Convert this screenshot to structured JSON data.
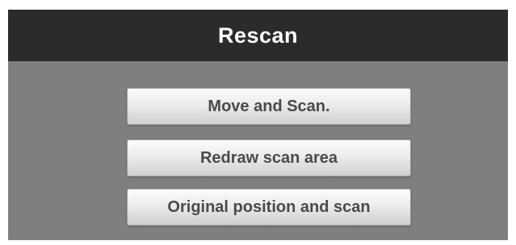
{
  "dialog": {
    "title": "Rescan",
    "buttons": [
      {
        "label": "Move and Scan."
      },
      {
        "label": "Redraw scan area"
      },
      {
        "label": "Original position and scan"
      }
    ]
  },
  "colors": {
    "title_bar": "#2b2b2b",
    "dialog_body": "#7f7f7f",
    "button_text": "#4a4a4a"
  }
}
